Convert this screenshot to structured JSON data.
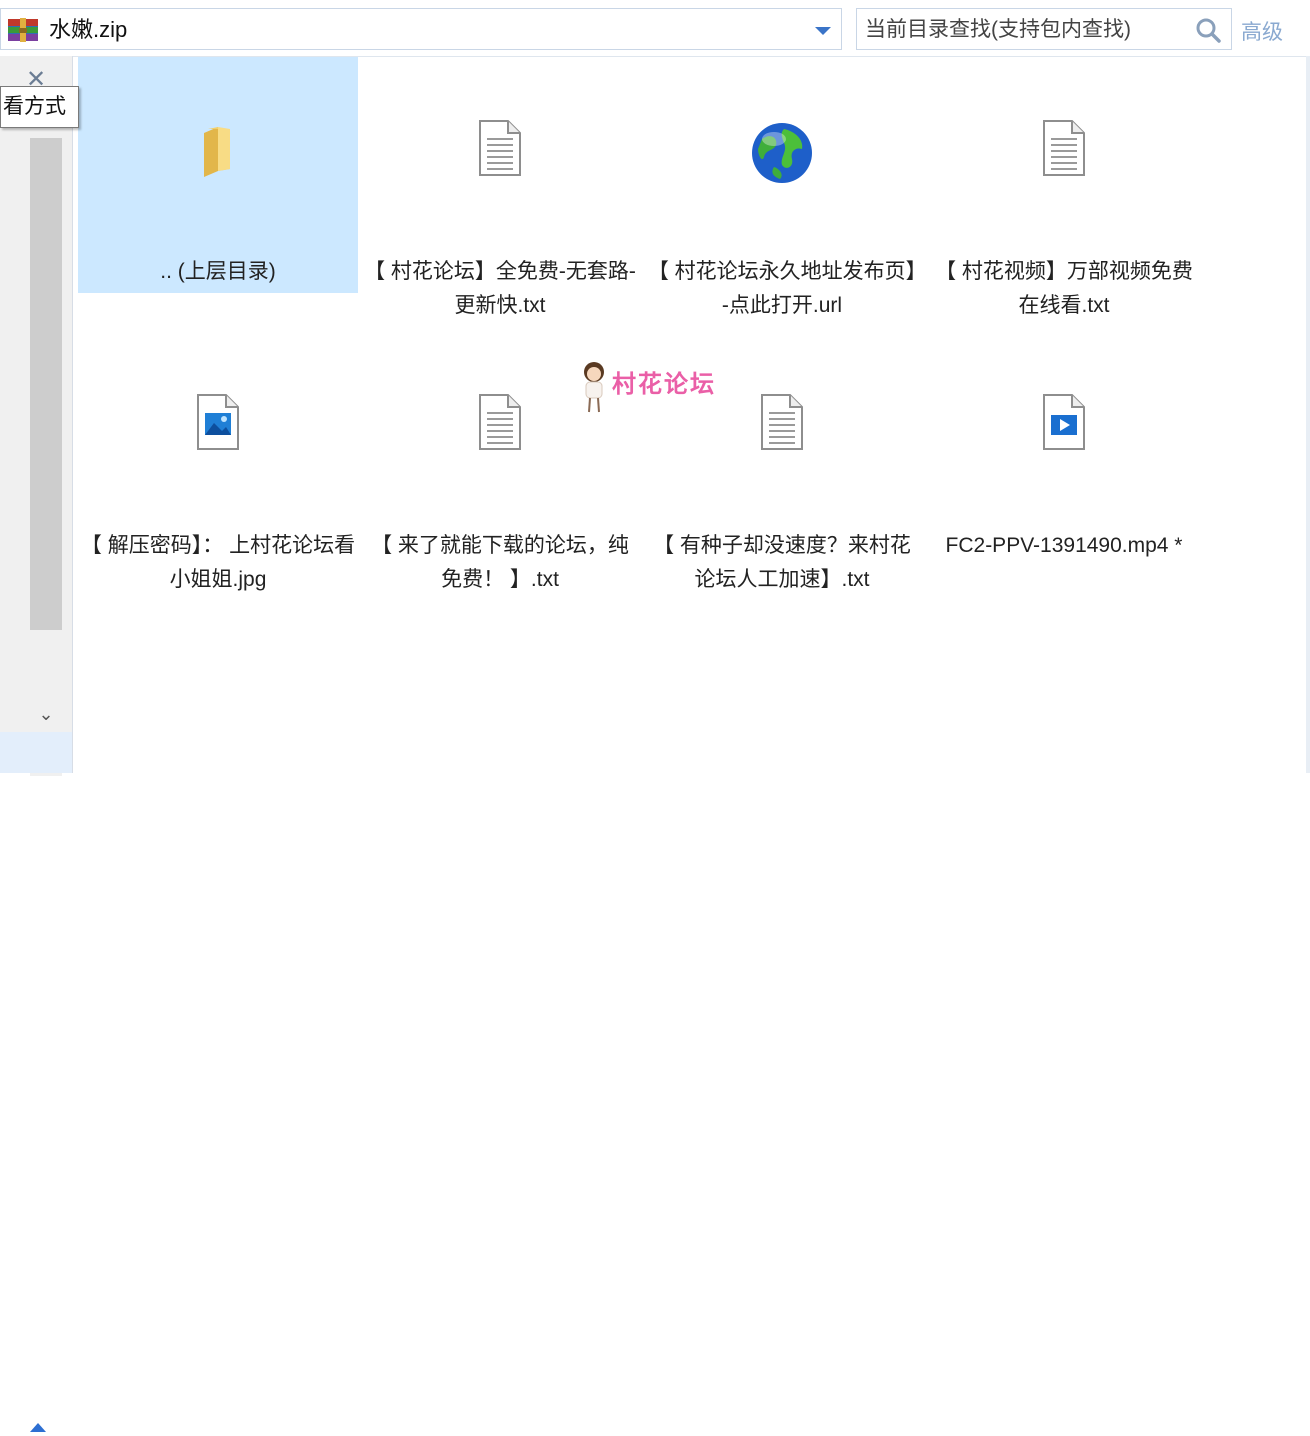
{
  "address": {
    "path": "水嫩.zip",
    "search_placeholder": "当前目录查找(支持包内查找)",
    "advanced": "高级"
  },
  "leftpane": {
    "tooltip": "看方式",
    "close_glyph": "✕",
    "scroll_down_glyph": "⌄"
  },
  "files": [
    {
      "label": ".. (上层目录)",
      "icon": "folder-up-icon",
      "selected": true
    },
    {
      "label": "【 村花论坛】全免费-无套路-更新快.txt",
      "icon": "text-file-icon"
    },
    {
      "label": "【 村花论坛永久地址发布页】-点此打开.url",
      "icon": "globe-icon"
    },
    {
      "label": "【 村花视频】万部视频免费在线看.txt",
      "icon": "text-file-icon"
    },
    {
      "label": "【 解压密码】： 上村花论坛看小姐姐.jpg",
      "icon": "image-file-icon"
    },
    {
      "label": "【 来了就能下载的论坛，纯免费！ 】.txt",
      "icon": "text-file-icon"
    },
    {
      "label": "【 有种子却没速度？来村花论坛人工加速】.txt",
      "icon": "text-file-icon"
    },
    {
      "label": "FC2-PPV-1391490.mp4 *",
      "icon": "video-file-icon"
    }
  ],
  "watermark": {
    "text": "村花论坛"
  },
  "colors": {
    "selection": "#cce8ff",
    "accent": "#2d6fd2",
    "watermark": "#ea5fa7"
  }
}
